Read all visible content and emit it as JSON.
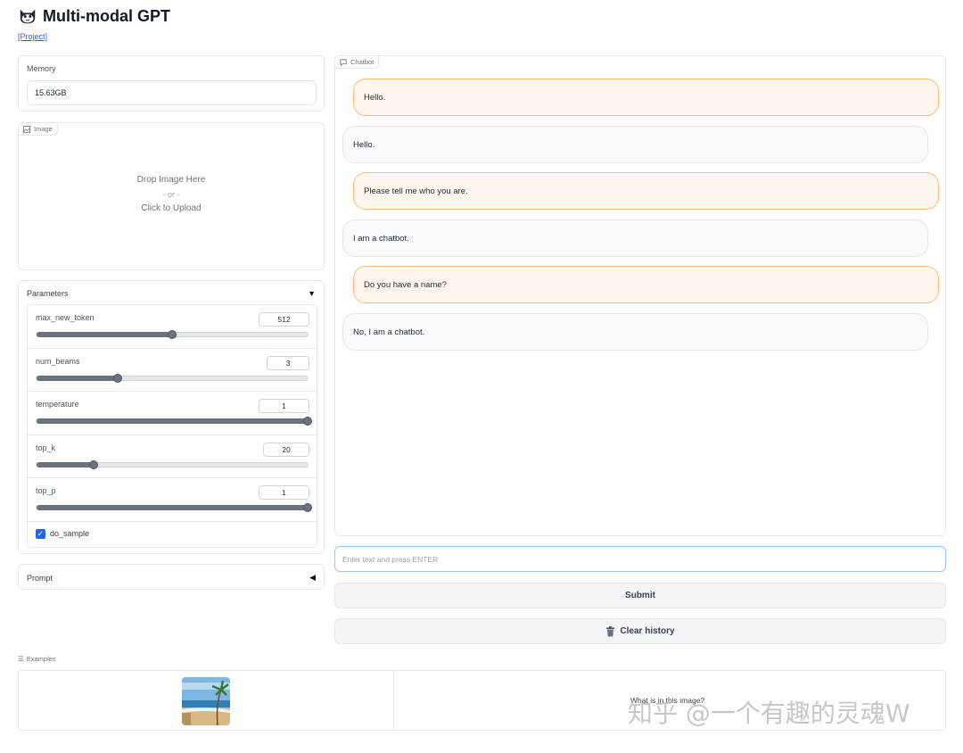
{
  "app": {
    "title": "Multi-modal GPT",
    "project_link": "[Project]"
  },
  "memory": {
    "label": "Memory",
    "value": "15.63GB"
  },
  "image_upload": {
    "label": "Image",
    "drop_text": "Drop Image Here",
    "or_text": "- or -",
    "click_text": "Click to Upload"
  },
  "parameters": {
    "label": "Parameters",
    "sliders": [
      {
        "name": "max_new_token",
        "value": "512",
        "fraction": 0.5
      },
      {
        "name": "num_beams",
        "value": "3",
        "fraction": 0.3
      },
      {
        "name": "temperature",
        "value": "1",
        "fraction": 1.0
      },
      {
        "name": "top_k",
        "value": "20",
        "fraction": 0.21
      },
      {
        "name": "top_p",
        "value": "1",
        "fraction": 1.0
      }
    ],
    "do_sample": {
      "label": "do_sample",
      "checked": true
    }
  },
  "prompt": {
    "label": "Prompt"
  },
  "chatbot": {
    "label": "Chatbot",
    "messages": [
      {
        "role": "user",
        "text": "Hello."
      },
      {
        "role": "bot",
        "text": "Hello."
      },
      {
        "role": "user",
        "text": "Please tell me who you are."
      },
      {
        "role": "bot",
        "text": "I am a chatbot."
      },
      {
        "role": "user",
        "text": "Do you have a name?"
      },
      {
        "role": "bot",
        "text": "No, I am a chatbot."
      }
    ]
  },
  "input": {
    "placeholder": "Enter text and press ENTER"
  },
  "buttons": {
    "submit": "Submit",
    "clear": "Clear history"
  },
  "examples": {
    "label": "Examples",
    "text": "What is in this image?"
  },
  "watermark": "知乎 @一个有趣的灵魂W",
  "colors": {
    "user_bubble": "#fff7ed",
    "user_border": "#fdba74",
    "bot_bubble": "#f9fafb",
    "accent": "#2563eb"
  },
  "icons": [
    "cat-logo-icon",
    "chat-icon",
    "image-icon",
    "trash-icon",
    "list-icon",
    "chevron-down-icon",
    "chevron-left-icon",
    "check-icon"
  ]
}
